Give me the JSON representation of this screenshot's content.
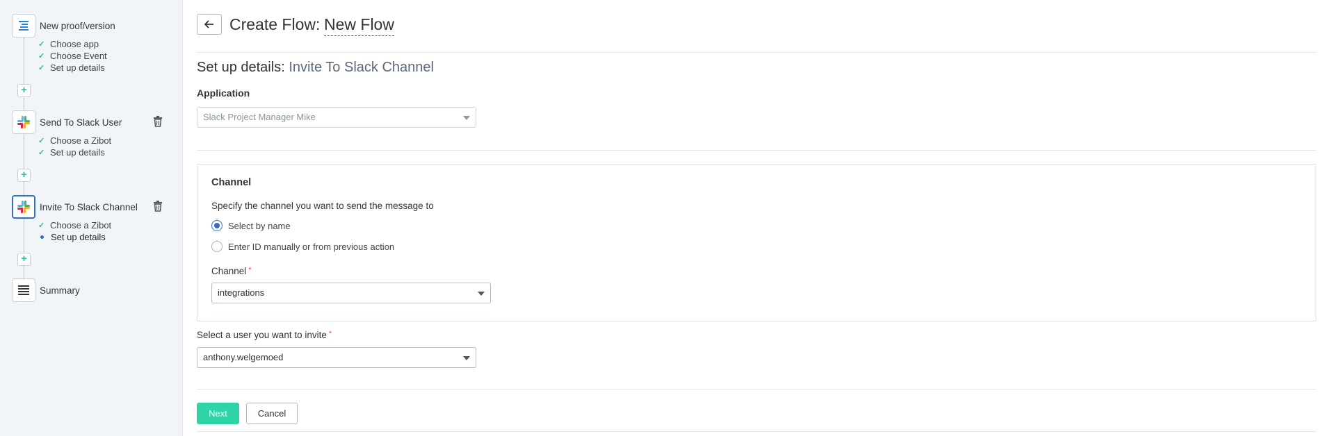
{
  "sidebar": {
    "steps": [
      {
        "title": "New proof/version",
        "icon": "proof-document-icon",
        "substeps": [
          {
            "label": "Choose app",
            "state": "done"
          },
          {
            "label": "Choose Event",
            "state": "done"
          },
          {
            "label": "Set up details",
            "state": "done"
          }
        ]
      },
      {
        "title": "Send To Slack User",
        "icon": "slack-icon",
        "deletable": true,
        "substeps": [
          {
            "label": "Choose a Zibot",
            "state": "done"
          },
          {
            "label": "Set up details",
            "state": "done"
          }
        ]
      },
      {
        "title": "Invite To Slack Channel",
        "icon": "slack-icon",
        "active": true,
        "deletable": true,
        "substeps": [
          {
            "label": "Choose a Zibot",
            "state": "done"
          },
          {
            "label": "Set up details",
            "state": "current"
          }
        ]
      },
      {
        "title": "Summary",
        "icon": "summary-lines-icon",
        "substeps": []
      }
    ],
    "add_step_symbol": "+"
  },
  "header": {
    "title": "Create Flow:",
    "flow_name": "New Flow"
  },
  "setup": {
    "heading": "Set up details:",
    "heading_action": "Invite To Slack Channel",
    "application_label": "Application",
    "application_value": "Slack Project Manager Mike"
  },
  "channel_section": {
    "title": "Channel",
    "prompt": "Specify the channel you want to send the message to",
    "options": [
      {
        "label": "Select by name",
        "selected": true
      },
      {
        "label": "Enter ID manually or from previous action",
        "selected": false
      }
    ],
    "field_label": "Channel",
    "field_value": "integrations",
    "required_mark": "*"
  },
  "user_section": {
    "label": "Select a user you want to invite",
    "value": "anthony.welgemoed",
    "required_mark": "*"
  },
  "actions": {
    "next_label": "Next",
    "cancel_label": "Cancel"
  },
  "colors": {
    "accent_green": "#2ed3a8",
    "active_blue": "#2f6fc4",
    "check_green": "#2ebd8f",
    "required_red": "#e04b4b"
  }
}
